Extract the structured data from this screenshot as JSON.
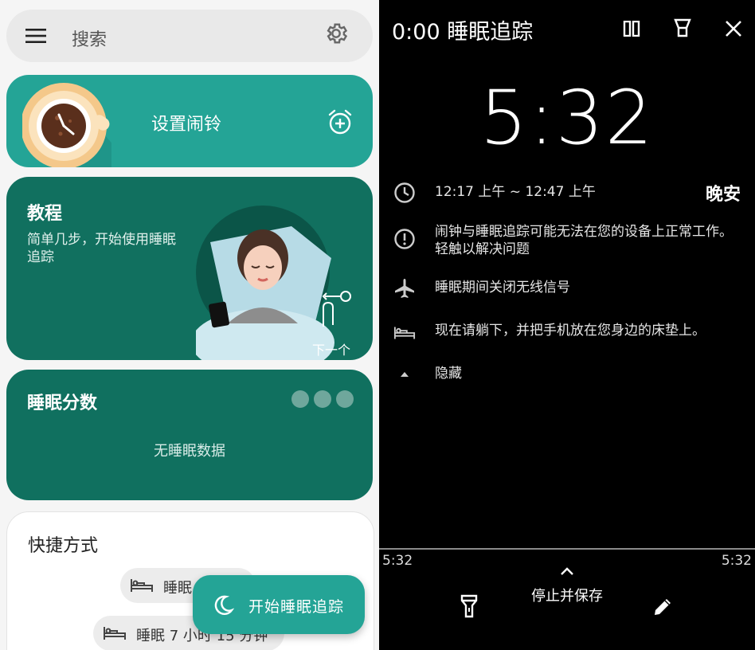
{
  "left": {
    "search": {
      "placeholder": "搜索"
    },
    "alarm_card": {
      "label": "设置闹铃"
    },
    "tutorial": {
      "title": "教程",
      "description": "简单几步，开始使用睡眠追踪",
      "next": "下一个"
    },
    "sleep_score": {
      "title": "睡眠分数",
      "empty": "无睡眠数据"
    },
    "shortcuts": {
      "title": "快捷方式",
      "items": [
        {
          "label": "睡眠"
        },
        {
          "label": "睡眠 7 小时 15 分钟"
        }
      ]
    },
    "fab": {
      "label": "开始睡眠追踪"
    }
  },
  "right": {
    "title": "0:00 睡眠追踪",
    "big_time": "5:32",
    "goodnight": "晚安",
    "rows": [
      {
        "icon": "clock-icon",
        "text": "12:17 上午 ~ 12:47 上午"
      },
      {
        "icon": "alert-circle-icon",
        "text": "闹钟与睡眠追踪可能无法在您的设备上正常工作。轻触以解决问题"
      },
      {
        "icon": "airplane-icon",
        "text": "睡眠期间关闭无线信号"
      },
      {
        "icon": "bed-icon",
        "text": "现在请躺下，并把手机放在您身边的床垫上。"
      },
      {
        "icon": "triangle-up-icon",
        "text": "隐藏"
      }
    ],
    "timeline_start": "5:32",
    "timeline_end": "5:32",
    "stop_label": "停止并保存"
  },
  "colors": {
    "teal": "#24a496",
    "dark_teal": "#11705f",
    "black": "#000000"
  }
}
